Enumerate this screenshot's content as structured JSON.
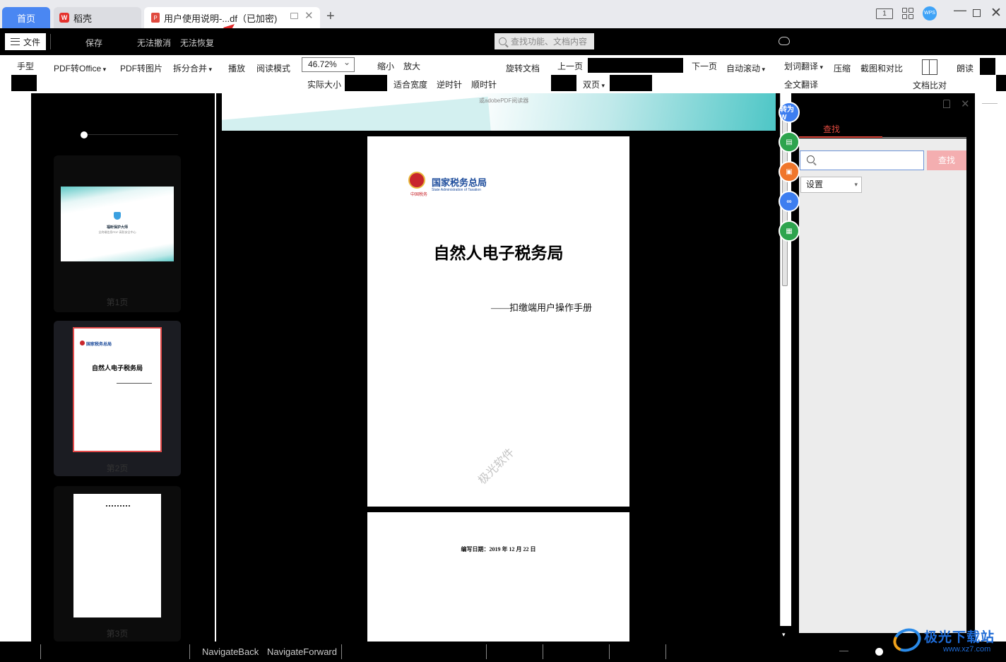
{
  "tabs": {
    "home": "首页",
    "daoke": "稻壳",
    "doc": "用户使用说明-...df（已加密)"
  },
  "menubar": {
    "file": "文件",
    "save": "保存",
    "undo": "无法撤消",
    "redo": "无法恢复",
    "search_placeholder": "查找功能、文档内容"
  },
  "ribbon": {
    "hand": "手型",
    "pdf_to_office": "PDF转Office",
    "pdf_to_image": "PDF转图片",
    "split_merge": "拆分合并",
    "play": "播放",
    "read_mode": "阅读模式",
    "zoom_value": "46.72%",
    "zoom_out": "缩小",
    "zoom_in": "放大",
    "actual_size": "实际大小",
    "fit_width": "适合宽度",
    "rotate_ccw": "逆时针",
    "rotate_cw": "顺时针",
    "rotate_doc": "旋转文档",
    "prev_page": "上一页",
    "next_page": "下一页",
    "auto_scroll": "自动滚动",
    "double_page": "双页",
    "word_translate": "划词翻译",
    "full_translate": "全文翻译",
    "compress": "压缩",
    "screenshot_compare": "截图和对比",
    "doc_compare": "文档比对",
    "read_aloud": "朗读"
  },
  "thumbnails": {
    "pages": [
      "第1页",
      "第2页",
      "第3页"
    ],
    "thumb1_title": "福昕保护大师",
    "thumb1_sub": "全终端信息PDF·高防安全中心",
    "thumb2_title": "自然人电子税务局",
    "thumb2_org": "国家税务总局",
    "thumb3_text": "编写日期：2019年12月22日"
  },
  "document": {
    "banner_text": "或adobePDF阅读器",
    "org_cn": "国家税务总局",
    "org_en": "State Administration of Taxation",
    "org_sub": "中国税务",
    "title": "自然人电子税务局",
    "subtitle": "——扣缴端用户操作手册",
    "watermark": "极光软件",
    "page2_date": "编写日期：2019 年 12 月 22 日"
  },
  "floatbar": {
    "convert_word": "转为W"
  },
  "findpanel": {
    "tab": "查找",
    "find_button": "查找",
    "search_value": "",
    "settings": "设置"
  },
  "statusbar": {
    "nav_back": "NavigateBack",
    "nav_forward": "NavigateForward"
  },
  "brand": {
    "name": "极光下载站",
    "url": "www.xz7.com"
  },
  "colors": {
    "accent_blue": "#4a87f2",
    "find_red": "#e04a3f",
    "float_blue": "#3d7ef0",
    "float_green": "#2da44e",
    "float_orange": "#f0762b"
  }
}
